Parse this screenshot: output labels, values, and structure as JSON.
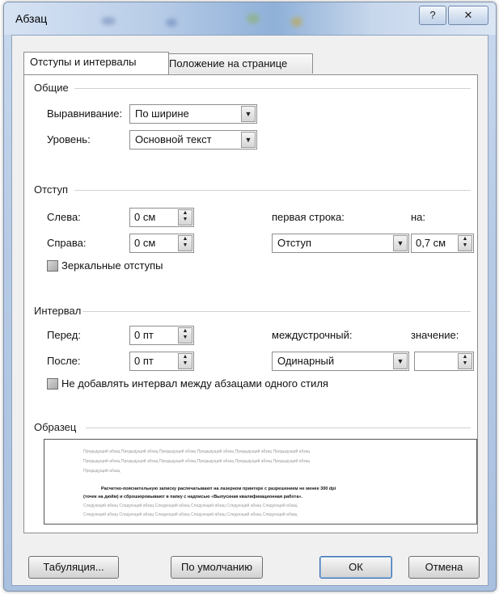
{
  "window": {
    "title": "Абзац",
    "help_label": "?",
    "close_label": "✕"
  },
  "tabs": [
    {
      "label": "Отступы и интервалы"
    },
    {
      "label": "Положение на странице"
    }
  ],
  "general": {
    "heading": "Общие",
    "alignment_label": "Выравнивание:",
    "alignment_value": "По ширине",
    "level_label": "Уровень:",
    "level_value": "Основной текст"
  },
  "indent": {
    "heading": "Отступ",
    "left_label": "Слева:",
    "left_value": "0 см",
    "right_label": "Справа:",
    "right_value": "0 см",
    "first_line_label": "первая строка:",
    "first_line_value": "Отступ",
    "by_label": "на:",
    "by_value": "0,7 см",
    "mirror_label": "Зеркальные отступы"
  },
  "spacing": {
    "heading": "Интервал",
    "before_label": "Перед:",
    "before_value": "0 пт",
    "after_label": "После:",
    "after_value": "0 пт",
    "line_label": "междустрочный:",
    "line_value": "Одинарный",
    "at_label": "значение:",
    "at_value": "",
    "no_space_label": "Не добавлять интервал между абзацами одного стиля"
  },
  "preview": {
    "heading": "Образец",
    "prev_lines": [
      "Предыдущий абзац Предыдущий абзац Предыдущий абзац Предыдущий абзац Предыдущий абзац Предыдущий абзац",
      "Предыдущий абзац Предыдущий абзац Предыдущий абзац Предыдущий абзац Предыдущий абзац Предыдущий абзац",
      "Предыдущий абзац"
    ],
    "main_lines": [
      "Расчетно-пояснительную записку распечатывают на лазерном принтере с разрешением не менее 300 dpi",
      "(точек на дюйм) и сброшюровывают в папку с надписью «Выпускная квалификационная работа»."
    ],
    "next_lines": [
      "Следующий абзац Следующий абзац Следующий абзац Следующий абзац Следующий абзац Следующий абзац",
      "Следующий абзац Следующий абзац Следующий абзац Следующий абзац Следующий абзац Следующий абзац"
    ]
  },
  "buttons": {
    "tabs_label": "Табуляция...",
    "default_label": "По умолчанию",
    "ok_label": "ОК",
    "cancel_label": "Отмена"
  }
}
